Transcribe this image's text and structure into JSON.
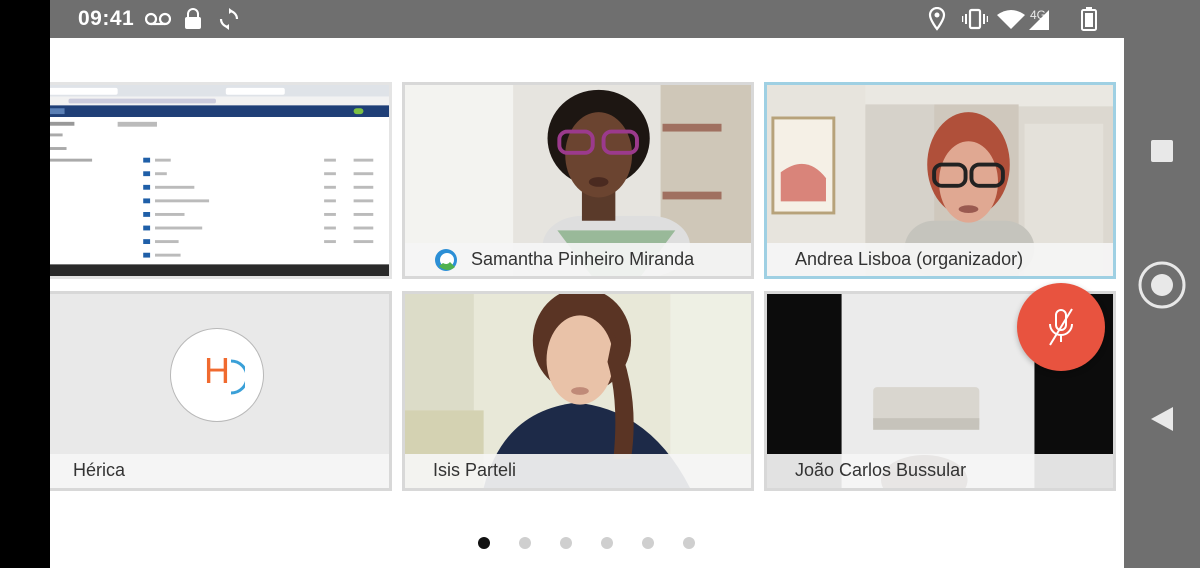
{
  "status_bar": {
    "time": "09:41",
    "network_label": "4G",
    "icons": [
      "voicemail-icon",
      "lock-icon",
      "sync-icon",
      "location-icon",
      "vibrate-icon",
      "wifi-icon",
      "signal-icon",
      "battery-icon"
    ]
  },
  "participants": [
    {
      "id": "screen-share",
      "name": ""
    },
    {
      "id": "samantha",
      "name": "Samantha Pinheiro Miranda",
      "badge": "meet-logo-icon"
    },
    {
      "id": "andrea",
      "name": "Andrea Lisboa (organizador)",
      "active": true
    },
    {
      "id": "herica",
      "name": "Hérica",
      "initial": "H"
    },
    {
      "id": "isis",
      "name": "Isis Parteli"
    },
    {
      "id": "joao",
      "name": "João Carlos Bussular"
    }
  ],
  "mute_button": {
    "icon": "mic-off-icon",
    "color": "#e8533f"
  },
  "pagination": {
    "count": 6,
    "current": 1
  },
  "nav_bar": {
    "buttons": [
      "recents-icon",
      "home-icon",
      "back-icon"
    ]
  },
  "colors": {
    "status_bar": "#6f6f6f",
    "active_border": "#9fd0e3",
    "avatar_accent": "#f06a2f"
  }
}
